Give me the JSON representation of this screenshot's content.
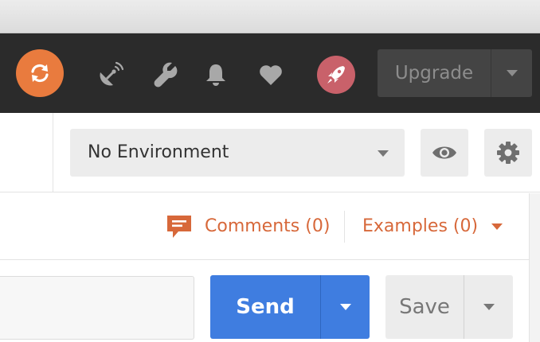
{
  "header": {
    "icons": [
      "sync-icon",
      "satellite-icon",
      "wrench-icon",
      "bell-icon",
      "heart-icon",
      "rocket-icon"
    ],
    "upgrade_label": "Upgrade"
  },
  "environment": {
    "selected": "No Environment"
  },
  "meta": {
    "comments_label": "Comments (0)",
    "examples_label": "Examples (0)"
  },
  "request": {
    "send_label": "Send",
    "save_label": "Save"
  },
  "colors": {
    "header_bg": "#2b2b2b",
    "sync_orange": "#e97b3e",
    "rocket_pink": "#c9616a",
    "accent_orange": "#d7683a",
    "send_blue": "#3f7de0"
  }
}
